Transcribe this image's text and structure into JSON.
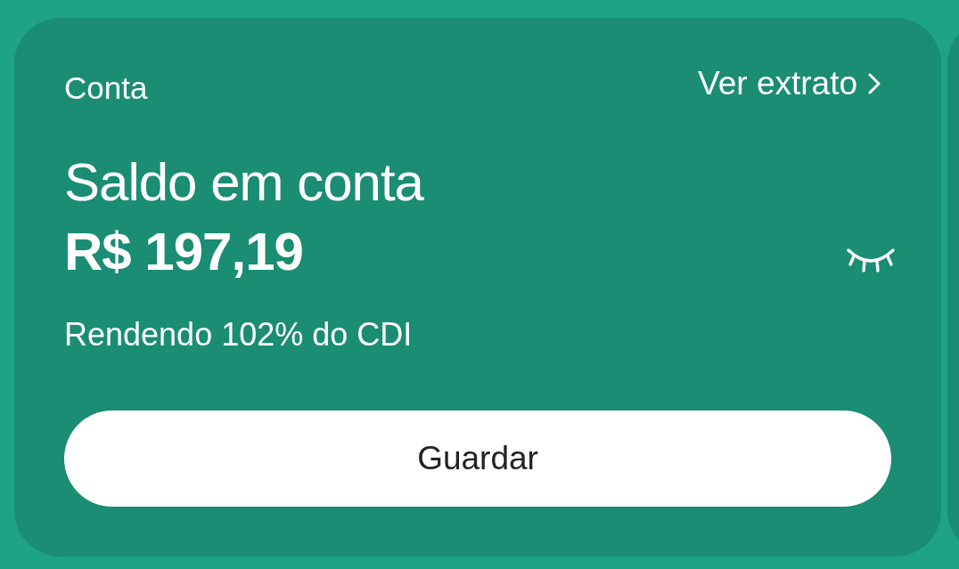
{
  "account_card": {
    "title": "Conta",
    "statement_link": "Ver extrato",
    "balance_label": "Saldo em conta",
    "balance": "R$ 197,19",
    "yield_text": "Rendendo 102% do CDI",
    "action_button": "Guardar"
  }
}
